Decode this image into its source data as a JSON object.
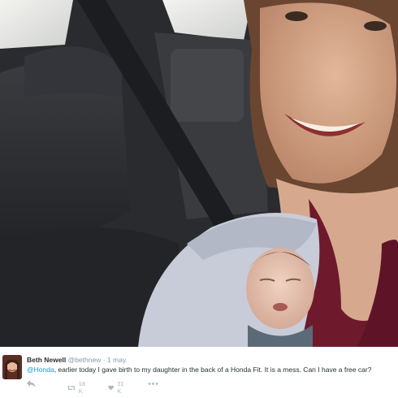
{
  "tweet": {
    "author_name": "Beth Newell",
    "author_handle": "@bethnew",
    "separator": "·",
    "date": "1 may.",
    "mention": "@Honda",
    "body": ", earlier today I gave birth to my daughter in the back of a Honda Fit. It is a mess. Can I have a free car?",
    "retweet_count": "18 K",
    "like_count": "31 K"
  },
  "icons": {
    "reply": "reply-arrow-icon",
    "retweet": "retweet-icon",
    "like": "heart-icon",
    "more": "more-dots-icon"
  },
  "colors": {
    "link": "#1b95e0",
    "name": "#292f33",
    "muted": "#8899a6",
    "action": "#aab8c2"
  }
}
